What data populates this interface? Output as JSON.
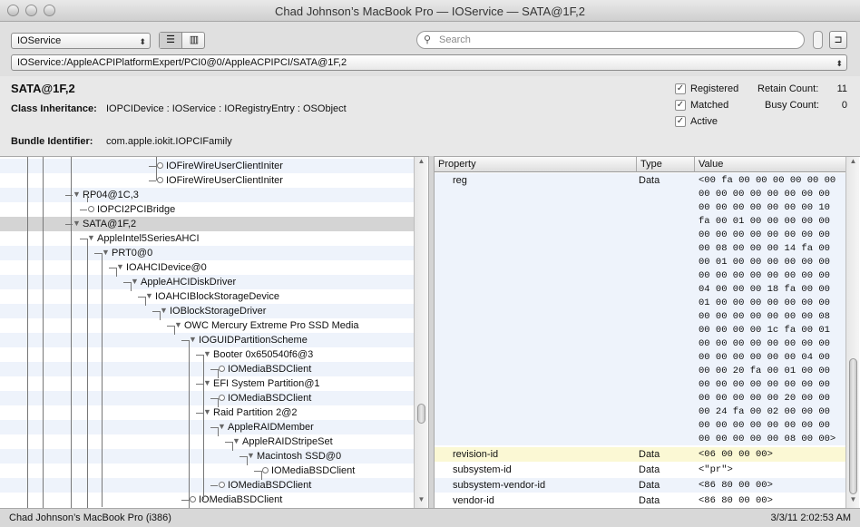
{
  "window": {
    "title": "Chad Johnson’s MacBook Pro — IOService — SATA@1F,2"
  },
  "toolbar": {
    "plane_select": "IOService",
    "path": "IOService:/AppleACPIPlatformExpert/PCI0@0/AppleACPIPCI/SATA@1F,2",
    "search_placeholder": "Search"
  },
  "info": {
    "name": "SATA@1F,2",
    "inheritance_label": "Class Inheritance:",
    "inheritance": "IOPCIDevice : IOService : IORegistryEntry : OSObject",
    "bundle_label": "Bundle Identifier:",
    "bundle": "com.apple.iokit.IOPCIFamily",
    "registered": "Registered",
    "matched": "Matched",
    "active": "Active",
    "retain_label": "Retain Count:",
    "retain": "11",
    "busy_label": "Busy Count:",
    "busy": "0"
  },
  "tree": [
    {
      "label": "IOFireWireUserClientIniter",
      "arrow": ""
    },
    {
      "label": "IOFireWireUserClientIniter",
      "arrow": ""
    },
    {
      "label": "RP04@1C,3",
      "arrow": "▼"
    },
    {
      "label": "IOPCI2PCIBridge",
      "arrow": ""
    },
    {
      "label": "SATA@1F,2",
      "arrow": "▼"
    },
    {
      "label": "AppleIntel5SeriesAHCI",
      "arrow": "▼"
    },
    {
      "label": "PRT0@0",
      "arrow": "▼"
    },
    {
      "label": "IOAHCIDevice@0",
      "arrow": "▼"
    },
    {
      "label": "AppleAHCIDiskDriver",
      "arrow": "▼"
    },
    {
      "label": "IOAHCIBlockStorageDevice",
      "arrow": "▼"
    },
    {
      "label": "IOBlockStorageDriver",
      "arrow": "▼"
    },
    {
      "label": "OWC Mercury Extreme Pro SSD Media",
      "arrow": "▼"
    },
    {
      "label": "IOGUIDPartitionScheme",
      "arrow": "▼"
    },
    {
      "label": "Booter 0x650540f6@3",
      "arrow": "▼"
    },
    {
      "label": "IOMediaBSDClient",
      "arrow": ""
    },
    {
      "label": "EFI System Partition@1",
      "arrow": "▼"
    },
    {
      "label": "IOMediaBSDClient",
      "arrow": ""
    },
    {
      "label": "Raid Partition 2@2",
      "arrow": "▼"
    },
    {
      "label": "AppleRAIDMember",
      "arrow": "▼"
    },
    {
      "label": "AppleRAIDStripeSet",
      "arrow": "▼"
    },
    {
      "label": "Macintosh SSD@0",
      "arrow": "▼"
    },
    {
      "label": "IOMediaBSDClient",
      "arrow": ""
    },
    {
      "label": "IOMediaBSDClient",
      "arrow": ""
    },
    {
      "label": "IOMediaBSDClient",
      "arrow": ""
    }
  ],
  "table": {
    "headers": [
      "Property",
      "Type",
      "Value"
    ],
    "reg": {
      "property": "reg",
      "type": "Data",
      "lines": [
        "<00 fa 00 00 00 00 00 00",
        "00 00 00 00 00 00 00 00",
        "00 00 00 00 00 00 00 10",
        "fa 00 01 00 00 00 00 00",
        "00 00 00 00 00 00 00 00",
        "00 08 00 00 00 14 fa 00",
        "00 01 00 00 00 00 00 00",
        "00 00 00 00 00 00 00 00",
        "04 00 00 00 18 fa 00 00",
        "01 00 00 00 00 00 00 00",
        "00 00 00 00 00 00 00 08",
        "00 00 00 00 1c fa 00 01",
        "00 00 00 00 00 00 00 00",
        "00 00 00 00 00 00 04 00",
        "00 00 20 fa 00 01 00 00",
        "00 00 00 00 00 00 00 00",
        "00 00 00 00 00 20 00 00",
        "00 24 fa 00 02 00 00 00",
        "00 00 00 00 00 00 00 00",
        "00 00 00 00 00 08 00 00>"
      ]
    },
    "rows": [
      {
        "property": "revision-id",
        "type": "Data",
        "value": "<06 00 00 00>"
      },
      {
        "property": "subsystem-id",
        "type": "Data",
        "value": "<\"pr\">"
      },
      {
        "property": "subsystem-vendor-id",
        "type": "Data",
        "value": "<86 80 00 00>"
      },
      {
        "property": "vendor-id",
        "type": "Data",
        "value": "<86 80 00 00>"
      }
    ]
  },
  "status": {
    "left": "Chad Johnson’s MacBook Pro (i386)",
    "right": "3/3/11 2:02:53 AM"
  }
}
